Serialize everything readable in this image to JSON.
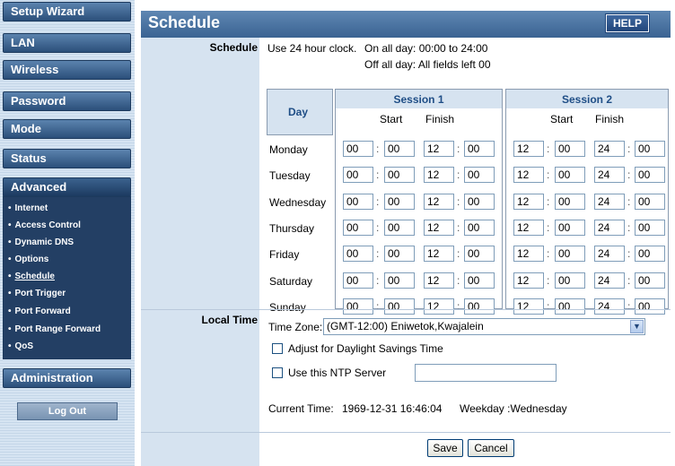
{
  "sidebar": {
    "nav": [
      "Setup Wizard",
      "LAN",
      "Wireless",
      "Password",
      "Mode",
      "Status",
      "Advanced",
      "Administration"
    ],
    "advanced_items": [
      "Internet",
      "Access Control",
      "Dynamic DNS",
      "Options",
      "Schedule",
      "Port Trigger",
      "Port Forward",
      "Port Range Forward",
      "QoS"
    ],
    "current_item": "Schedule",
    "logout": "Log Out"
  },
  "header": {
    "title": "Schedule",
    "help": "HELP"
  },
  "schedule": {
    "section_label": "Schedule",
    "hint1": "Use 24 hour clock.",
    "hint2": "On all day: 00:00 to 24:00",
    "hint3": "Off all day: All fields left 00",
    "day_header": "Day",
    "session1_title": "Session 1",
    "session2_title": "Session 2",
    "start": "Start",
    "finish": "Finish",
    "separator": ":",
    "rows": [
      {
        "day": "Monday",
        "s1": [
          "00",
          "00",
          "12",
          "00"
        ],
        "s2": [
          "12",
          "00",
          "24",
          "00"
        ]
      },
      {
        "day": "Tuesday",
        "s1": [
          "00",
          "00",
          "12",
          "00"
        ],
        "s2": [
          "12",
          "00",
          "24",
          "00"
        ]
      },
      {
        "day": "Wednesday",
        "s1": [
          "00",
          "00",
          "12",
          "00"
        ],
        "s2": [
          "12",
          "00",
          "24",
          "00"
        ]
      },
      {
        "day": "Thursday",
        "s1": [
          "00",
          "00",
          "12",
          "00"
        ],
        "s2": [
          "12",
          "00",
          "24",
          "00"
        ]
      },
      {
        "day": "Friday",
        "s1": [
          "00",
          "00",
          "12",
          "00"
        ],
        "s2": [
          "12",
          "00",
          "24",
          "00"
        ]
      },
      {
        "day": "Saturday",
        "s1": [
          "00",
          "00",
          "12",
          "00"
        ],
        "s2": [
          "12",
          "00",
          "24",
          "00"
        ]
      },
      {
        "day": "Sunday",
        "s1": [
          "00",
          "00",
          "12",
          "00"
        ],
        "s2": [
          "12",
          "00",
          "24",
          "00"
        ]
      }
    ]
  },
  "local_time": {
    "section_label": "Local Time",
    "tz_label": "Time Zone:",
    "tz_value": "(GMT-12:00) Eniwetok,Kwajalein",
    "dst_label": "Adjust for Daylight Savings Time",
    "dst_checked": false,
    "ntp_label": "Use this NTP Server",
    "ntp_checked": false,
    "ntp_value": "",
    "current_time_label": "Current Time:",
    "current_time_value": "1969-12-31 16:46:04",
    "weekday": "Weekday :Wednesday"
  },
  "actions": {
    "save": "Save",
    "cancel": "Cancel"
  }
}
